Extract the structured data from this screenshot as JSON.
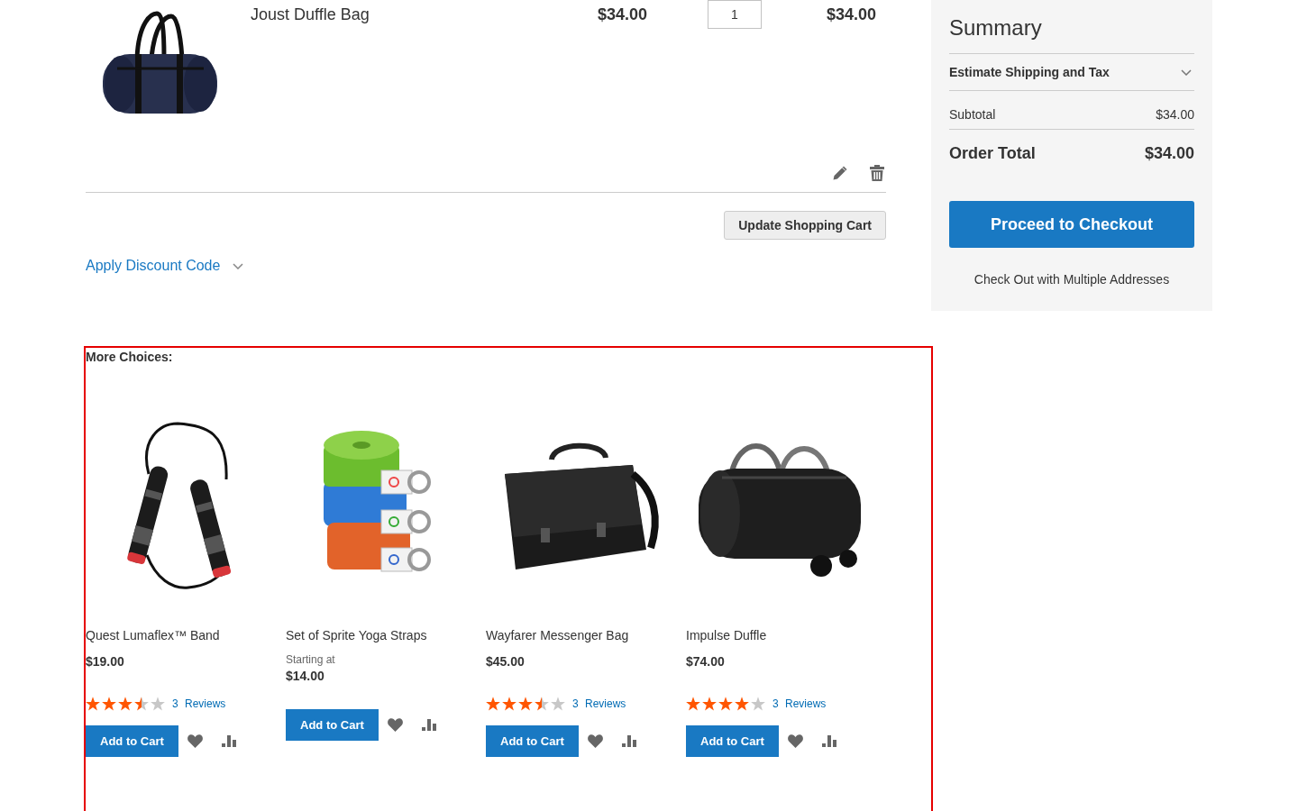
{
  "cart_item": {
    "name": "Joust Duffle Bag",
    "price": "$34.00",
    "qty": "1",
    "subtotal": "$34.00"
  },
  "update_cart_button": "Update Shopping Cart",
  "discount": {
    "label": "Apply Discount Code",
    "expanded": false
  },
  "more_choices": {
    "title": "More Choices:",
    "products": [
      {
        "name": "Quest Lumaflex™ Band",
        "price": "$19.00",
        "stars": 3.5,
        "reviews": "3 Reviews",
        "button": "Add to Cart"
      },
      {
        "name": "Set of Sprite Yoga Straps",
        "price_prefix": "Starting at",
        "price": "$14.00",
        "button": "Add to Cart"
      },
      {
        "name": "Wayfarer Messenger Bag",
        "price": "$45.00",
        "stars": 3.5,
        "reviews": "3 Reviews",
        "button": "Add to Cart"
      },
      {
        "name": "Impulse Duffle",
        "price": "$74.00",
        "stars": 4,
        "reviews": "3 Reviews",
        "button": "Add to Cart"
      }
    ]
  },
  "summary": {
    "title": "Summary",
    "estimate": {
      "label": "Estimate Shipping and Tax",
      "expanded": false
    },
    "subtotal": {
      "label": "Subtotal",
      "value": "$34.00"
    },
    "order_total": {
      "label": "Order Total",
      "value": "$34.00"
    },
    "checkout_button": "Proceed to Checkout",
    "multishipping_link": "Check Out with Multiple Addresses"
  }
}
